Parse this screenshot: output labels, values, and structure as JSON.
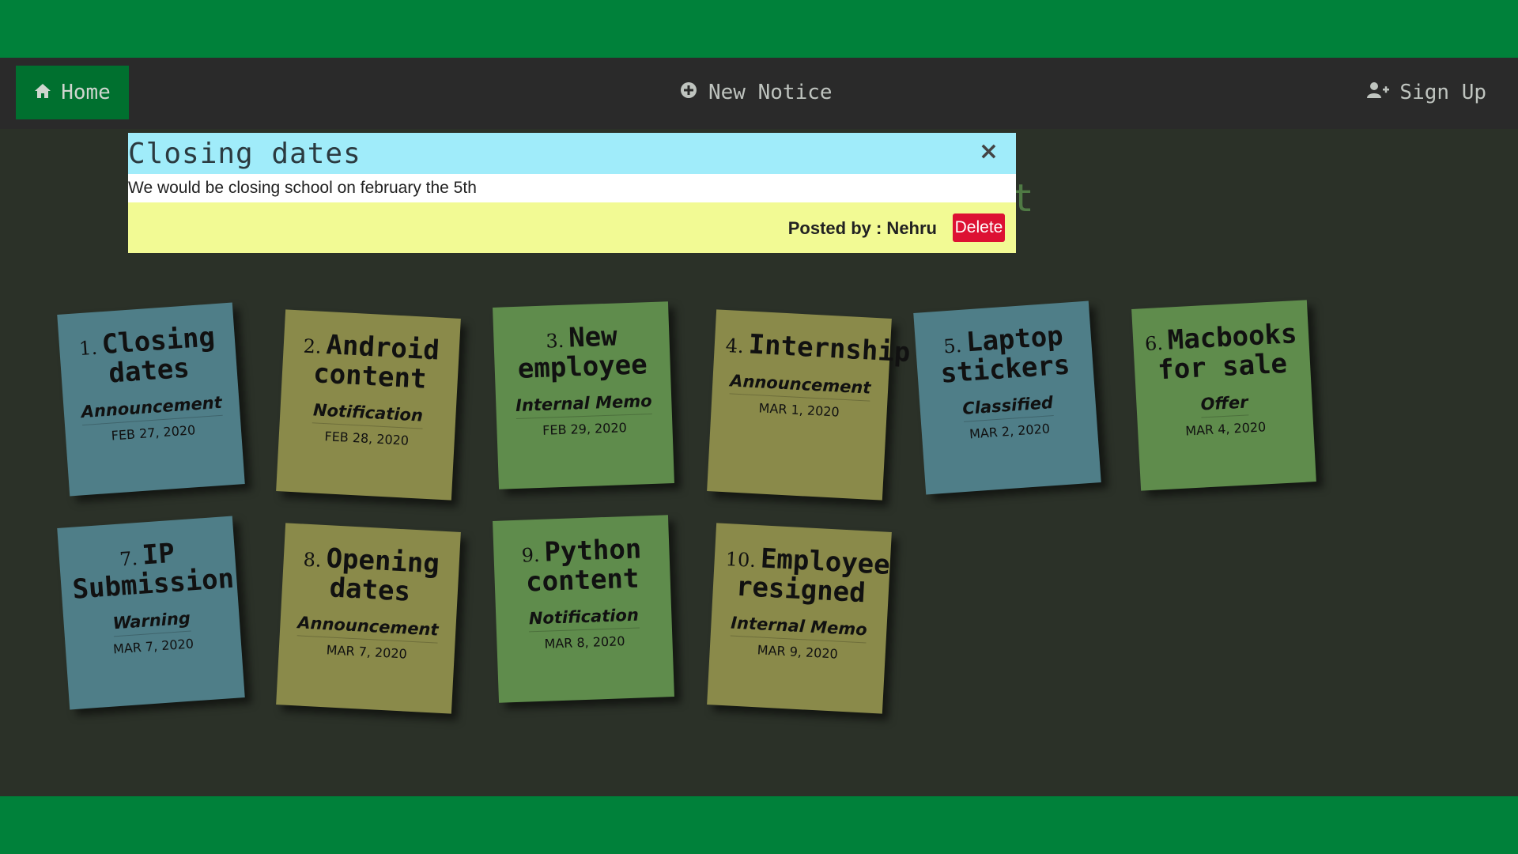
{
  "nav": {
    "home_label": "Home",
    "new_notice_label": "New Notice",
    "signup_label": "Sign Up"
  },
  "background_heading": "nt",
  "modal": {
    "title": "Closing dates",
    "body": "We would be closing school on february the 5th",
    "posted_by": "Posted by : Nehru",
    "delete_label": "Delete",
    "close_glyph": "×"
  },
  "notes": [
    {
      "num": "1.",
      "title": "Closing dates",
      "category": "Announcement",
      "date": "FEB 27, 2020",
      "color": "#4f7e88"
    },
    {
      "num": "2.",
      "title": "Android content",
      "category": "Notification",
      "date": "FEB 28, 2020",
      "color": "#8a8a4a"
    },
    {
      "num": "3.",
      "title": "New employee",
      "category": "Internal Memo",
      "date": "FEB 29, 2020",
      "color": "#5f8c4c"
    },
    {
      "num": "4.",
      "title": "Internship",
      "category": "Announcement",
      "date": "MAR 1, 2020",
      "color": "#8a8a4a"
    },
    {
      "num": "5.",
      "title": "Laptop stickers",
      "category": "Classified",
      "date": "MAR 2, 2020",
      "color": "#4f7e88"
    },
    {
      "num": "6.",
      "title": "Macbooks for sale",
      "category": "Offer",
      "date": "MAR 4, 2020",
      "color": "#5f8c4c"
    },
    {
      "num": "7.",
      "title": "IP Submission",
      "category": "Warning",
      "date": "MAR 7, 2020",
      "color": "#4f7e88"
    },
    {
      "num": "8.",
      "title": "Opening dates",
      "category": "Announcement",
      "date": "MAR 7, 2020",
      "color": "#8a8a4a"
    },
    {
      "num": "9.",
      "title": "Python content",
      "category": "Notification",
      "date": "MAR 8, 2020",
      "color": "#5f8c4c"
    },
    {
      "num": "10.",
      "title": "Employee resigned",
      "category": "Internal Memo",
      "date": "MAR 9, 2020",
      "color": "#8a8a4a"
    }
  ]
}
